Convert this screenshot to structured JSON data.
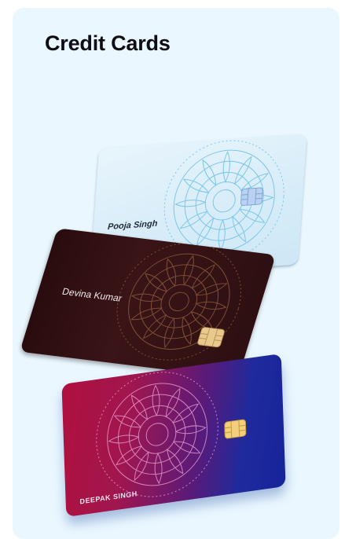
{
  "header": {
    "title": "Credit Cards"
  },
  "cards": [
    {
      "holder": "Pooja Singh",
      "theme": "light-blue",
      "colors": {
        "base": "#d6ecf8",
        "pattern": "#7cc6ea"
      }
    },
    {
      "holder": "Devina Kumar",
      "theme": "dark-brown",
      "colors": {
        "base": "#2e1012",
        "pattern": "#8a5a3c"
      }
    },
    {
      "holder": "DEEPAK SINGH",
      "theme": "red-blue-gradient",
      "colors": {
        "start": "#b0103e",
        "end": "#16249a",
        "pattern": "#f0a8d8"
      }
    }
  ]
}
